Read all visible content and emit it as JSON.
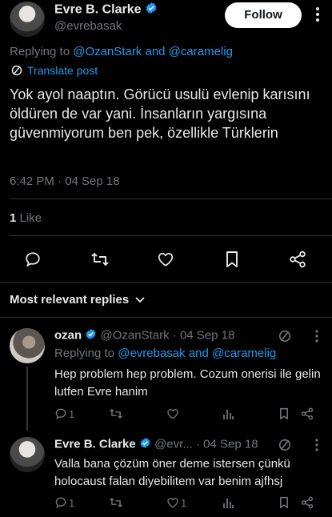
{
  "post": {
    "author_name": "Evre B. Clarke",
    "author_handle": "@evrebasak",
    "follow_label": "Follow",
    "replying_prefix": "Replying to",
    "replying_users": "@OzanStark and @caramelig",
    "translate_label": "Translate post",
    "text": "Yok ayol naaptın. Görücü usulü evlenip karısını öldüren de var yani. İnsanların yargısına güvenmiyorum ben pek, özellikle Türklerin",
    "timestamp": "6:42 PM · 04 Sep 18",
    "likes_count": "1",
    "likes_label": "Like"
  },
  "replies_header": "Most relevant replies",
  "replies": [
    {
      "author_name": "ozan",
      "author_handle": "@OzanStark",
      "date": "· 04 Sep 18",
      "replying_prefix": "Replying to",
      "replying_users": "@evrebasak and @caramelig",
      "text": "Hep problem hep problem. Cozum onerisi ile gelin lutfen Evre hanim",
      "reply_count": "1",
      "like_count": ""
    },
    {
      "author_name": "Evre B. Clarke",
      "author_handle": "@evr...",
      "date": "· 04 Sep 18",
      "text": "Valla bana çözüm öner deme istersen çünkü holocaust falan diyebilitem var benim ajfhsj",
      "reply_count": "1",
      "like_count": "1"
    }
  ],
  "colors": {
    "accent": "#1d9bf0",
    "muted": "#71767b",
    "text": "#e7e9ea",
    "background": "#000000"
  }
}
